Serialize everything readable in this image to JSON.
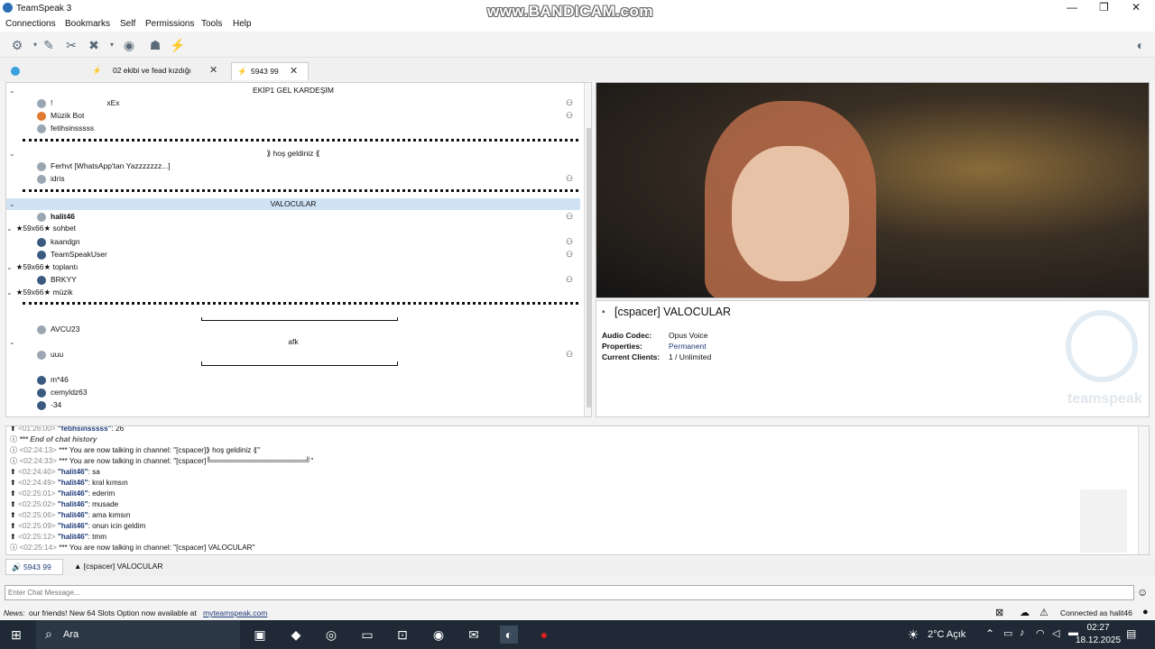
{
  "app": {
    "title": "TeamSpeak 3",
    "watermark": "www.BANDICAM.com"
  },
  "menu": [
    "Connections",
    "Bookmarks",
    "Self",
    "Permissions",
    "Tools",
    "Help"
  ],
  "tabs": [
    {
      "label": ""
    },
    {
      "label": "02 ekibi ve fead kızdığı"
    },
    {
      "label": "5943 99"
    }
  ],
  "tree": {
    "rows": [
      {
        "type": "channel",
        "label": "EKİP1 GEL KARDEŞİM",
        "center": true
      },
      {
        "type": "client",
        "label": "!",
        "extra": "xEx"
      },
      {
        "type": "client",
        "label": "Müzik Bot"
      },
      {
        "type": "client",
        "label": "fetihsinsssss"
      },
      {
        "type": "spacer"
      },
      {
        "type": "channel",
        "label": "⟫ hoş geldiniz ⟪",
        "center": true
      },
      {
        "type": "client",
        "label": "Ferhvt [WhatsApp'tan Yazzzzzzz...]"
      },
      {
        "type": "client",
        "label": "idris"
      },
      {
        "type": "spacer"
      },
      {
        "type": "channel",
        "label": "VALOCULAR",
        "center": true,
        "selected": true
      },
      {
        "type": "client",
        "label": "halit46",
        "bold": true
      },
      {
        "type": "subchannel",
        "label": "★59x66★ sohbet"
      },
      {
        "type": "client",
        "label": "kaandgn"
      },
      {
        "type": "client",
        "label": "TeamSpeakUser"
      },
      {
        "type": "subchannel",
        "label": "★59x66★ toplantı"
      },
      {
        "type": "client",
        "label": "BRKYY"
      },
      {
        "type": "subchannel",
        "label": "★59x66★ müzik"
      },
      {
        "type": "spacer"
      },
      {
        "type": "client",
        "label": "AVCU23"
      },
      {
        "type": "channel",
        "label": "afk",
        "center": true
      },
      {
        "type": "client",
        "label": "uuu"
      },
      {
        "type": "client",
        "label": "m*46"
      },
      {
        "type": "client",
        "label": "cemyldz63"
      },
      {
        "type": "client",
        "label": "-34"
      }
    ]
  },
  "info": {
    "title": "[cspacer] VALOCULAR",
    "codec_label": "Audio Codec:",
    "codec": "Opus Voice",
    "props_label": "Properties:",
    "props": "Permanent",
    "clients_label": "Current Clients:",
    "clients": "1 / Unlimited",
    "brand": "teamspeak"
  },
  "chat": {
    "lines": [
      {
        "time": "<01:26:00>",
        "name": "\"fetihsinsssss\"",
        "text": ": 26"
      },
      {
        "time": "",
        "name": "",
        "text": "*** End of chat history"
      },
      {
        "time": "<02:24:13>",
        "name": "",
        "text": "*** You are now talking in channel: \"[cspacer]⟫ hoş geldiniz ⟪\""
      },
      {
        "time": "<02:24:33>",
        "name": "",
        "text": "*** You are now talking in channel: \"[cspacer]╚══════════════════╝\""
      },
      {
        "time": "<02:24:40>",
        "name": "\"halit46\"",
        "text": ": sa"
      },
      {
        "time": "<02:24:49>",
        "name": "\"halit46\"",
        "text": ": kral kımsın"
      },
      {
        "time": "<02:25:01>",
        "name": "\"halit46\"",
        "text": ": ederim"
      },
      {
        "time": "<02:25:02>",
        "name": "\"halit46\"",
        "text": ": musade"
      },
      {
        "time": "<02:25:06>",
        "name": "\"halit46\"",
        "text": ": ama kımsın"
      },
      {
        "time": "<02:25:09>",
        "name": "\"halit46\"",
        "text": ": onun icin geldim"
      },
      {
        "time": "<02:25:12>",
        "name": "\"halit46\"",
        "text": ": tmm"
      },
      {
        "time": "<02:25:14>",
        "name": "",
        "text": "*** You are now talking in channel: \"[cspacer] VALOCULAR\""
      }
    ]
  },
  "chattabs": [
    "5943 99",
    "[cspacer] VALOCULAR"
  ],
  "input_placeholder": "Enter Chat Message...",
  "status": {
    "news_prefix": "News:",
    "news": "our friends! New 64 Slots Option now available at",
    "link": "myteamspeak.com",
    "connected": "Connected as halit46"
  },
  "taskbar": {
    "search": "Ara",
    "weather": "2°C Açık",
    "time": "02:27",
    "date": "18.12.2025"
  }
}
